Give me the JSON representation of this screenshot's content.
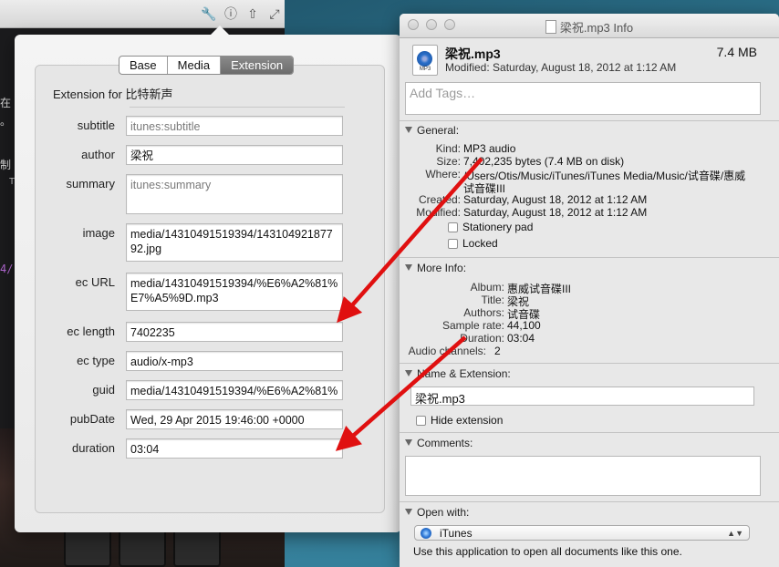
{
  "terminal": {
    "lines": [
      "在",
      "。",
      "制",
      "T",
      "4/"
    ],
    "toolbar_icons": [
      "wrench-icon",
      "info-icon",
      "share-icon",
      "expand-icon"
    ]
  },
  "popover": {
    "tabs": [
      "Base",
      "Media",
      "Extension"
    ],
    "active_tab": "Extension",
    "section_title": "Extension for 比特新声",
    "fields": {
      "subtitle": {
        "label": "subtitle",
        "placeholder": "itunes:subtitle",
        "value": ""
      },
      "author": {
        "label": "author",
        "value": "梁祝"
      },
      "summary": {
        "label": "summary",
        "placeholder": "itunes:summary",
        "value": ""
      },
      "image": {
        "label": "image",
        "value": "media/14310491519394/14310492187792.jpg"
      },
      "ec_url": {
        "label": "ec URL",
        "value": "media/14310491519394/%E6%A2%81%E7%A5%9D.mp3"
      },
      "ec_length": {
        "label": "ec length",
        "value": "7402235"
      },
      "ec_type": {
        "label": "ec type",
        "value": "audio/x-mp3"
      },
      "guid": {
        "label": "guid",
        "value": "media/14310491519394/%E6%A2%81%"
      },
      "pubdate": {
        "label": "pubDate",
        "value": "Wed, 29 Apr 2015 19:46:00 +0000"
      },
      "duration": {
        "label": "duration",
        "value": "03:04"
      }
    }
  },
  "info_window": {
    "title": "梁祝.mp3 Info",
    "file_name": "梁祝.mp3",
    "file_size": "7.4 MB",
    "icon_label": "MP3",
    "modified": "Modified: Saturday, August 18, 2012 at 1:12 AM",
    "tags_placeholder": "Add Tags…",
    "general": {
      "header": "General:",
      "kind_k": "Kind:",
      "kind_v": "MP3 audio",
      "size_k": "Size:",
      "size_v": "7,402,235 bytes (7.4 MB on disk)",
      "where_k": "Where:",
      "where_v1": "/Users/Otis/Music/iTunes/iTunes Media/Music/试音碟/惠威",
      "where_v2": "试音碟III",
      "created_k": "Created:",
      "created_v": "Saturday, August 18, 2012 at 1:12 AM",
      "modified_k": "Modified:",
      "modified_v": "Saturday, August 18, 2012 at 1:12 AM",
      "stationery": "Stationery pad",
      "locked": "Locked"
    },
    "more_info": {
      "header": "More Info:",
      "album_k": "Album:",
      "album_v": "惠威试音碟III",
      "title_k": "Title:",
      "title_v": "梁祝",
      "authors_k": "Authors:",
      "authors_v": "试音碟",
      "sample_k": "Sample rate:",
      "sample_v": "44,100",
      "duration_k": "Duration:",
      "duration_v": "03:04",
      "channels_k": "Audio channels:",
      "channels_v": "2"
    },
    "name_ext": {
      "header": "Name & Extension:",
      "value": "梁祝.mp3",
      "hide_ext": "Hide extension"
    },
    "comments": {
      "header": "Comments:"
    },
    "open_with": {
      "header": "Open with:",
      "app": "iTunes",
      "note": "Use this application to open all documents like this one."
    }
  },
  "colors": {
    "arrow": "#e01010",
    "active_tab": "#6f6f6f"
  }
}
